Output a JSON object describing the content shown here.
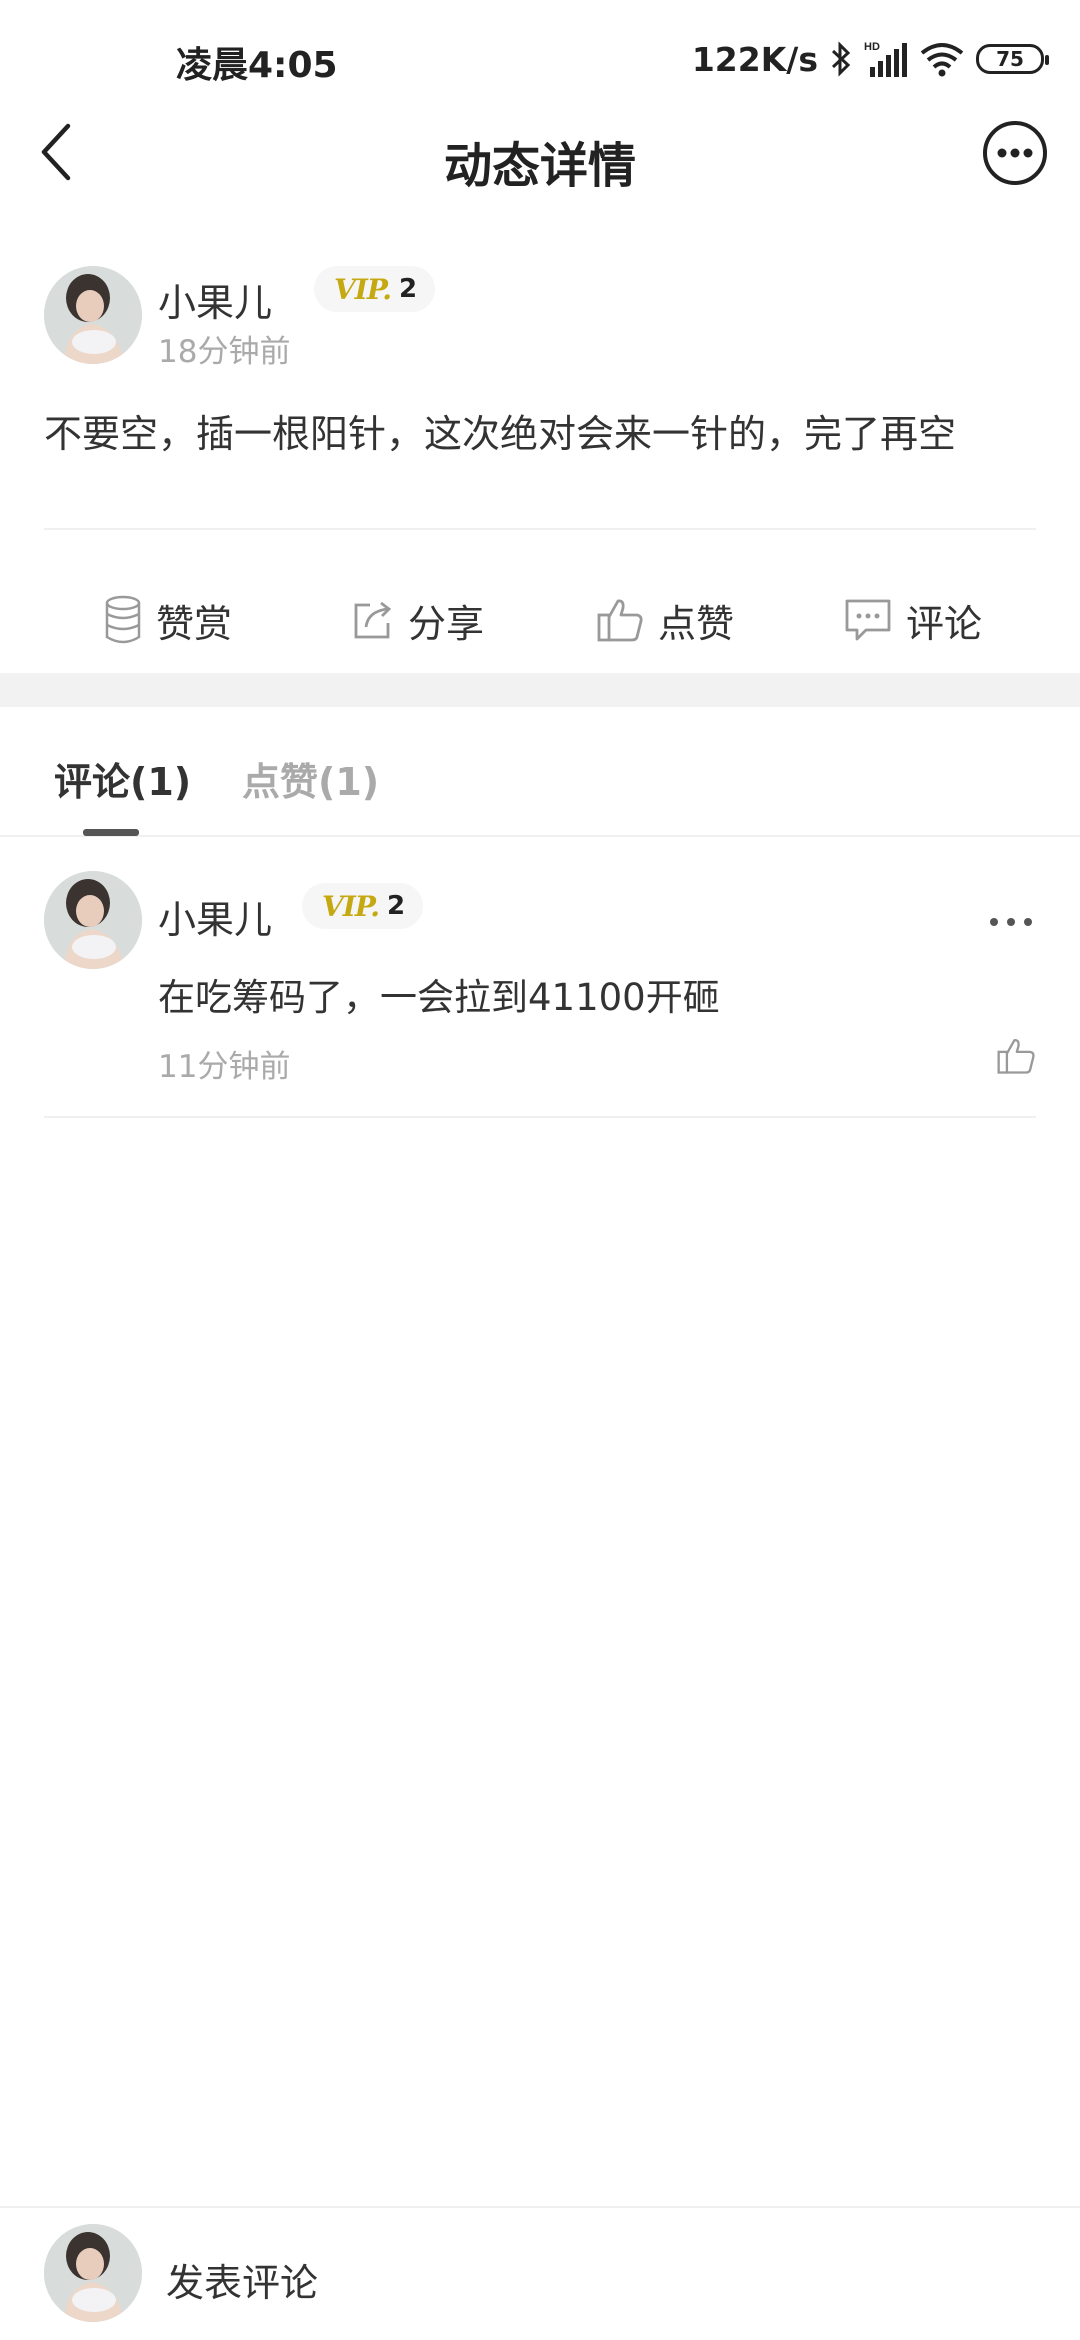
{
  "status_bar": {
    "time": "凌晨4:05",
    "net_speed": "122K/s",
    "battery": "75"
  },
  "nav": {
    "title": "动态详情"
  },
  "post": {
    "author": "小果儿",
    "vip_text": "VIP.",
    "vip_level": "2",
    "time": "18分钟前",
    "content": "不要空，插一根阳针，这次绝对会来一针的，完了再空"
  },
  "actions": {
    "reward": "赞赏",
    "share": "分享",
    "like": "点赞",
    "comment": "评论"
  },
  "tabs": {
    "comments": "评论(1)",
    "likes": "点赞(1)"
  },
  "comments": [
    {
      "author": "小果儿",
      "vip_text": "VIP.",
      "vip_level": "2",
      "text": "在吃筹码了，一会拉到41100开砸",
      "time": "11分钟前"
    }
  ],
  "bottom_bar": {
    "placeholder": "发表评论"
  },
  "colors": {
    "accent_vip": "#c5a912",
    "text_primary": "#333333",
    "text_secondary": "#aaaaaa",
    "section_gap": "#f2f2f2"
  }
}
